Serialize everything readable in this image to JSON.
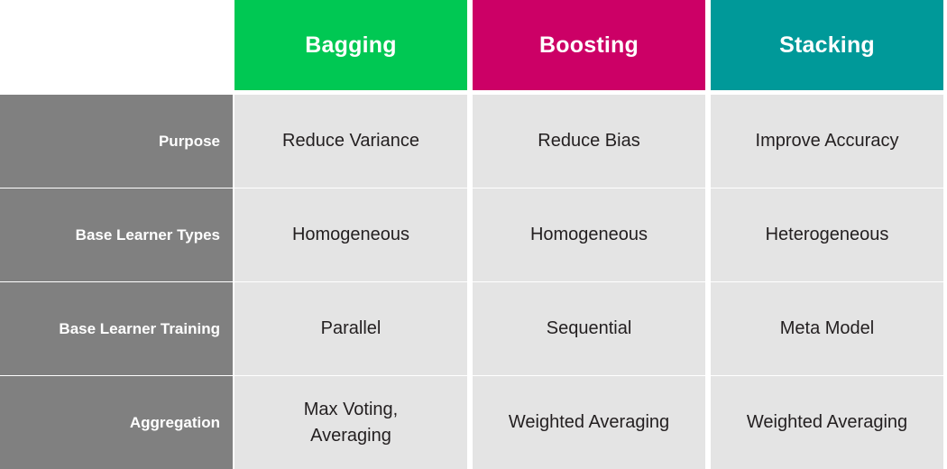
{
  "table": {
    "corner_label": "",
    "columns": [
      {
        "label": "Bagging",
        "color": "#00c853",
        "key": "bagging"
      },
      {
        "label": "Boosting",
        "color": "#cc0066",
        "key": "boosting"
      },
      {
        "label": "Stacking",
        "color": "#009999",
        "key": "stacking"
      }
    ],
    "row_labels": [
      "Purpose",
      "Base Learner Types",
      "Base Learner Training",
      "Aggregation"
    ],
    "rows": [
      {
        "label": "Purpose",
        "cells": [
          "Reduce Variance",
          "Reduce Bias",
          "Improve Accuracy"
        ]
      },
      {
        "label": "Base Learner Types",
        "cells": [
          "Homogeneous",
          "Homogeneous",
          "Heterogeneous"
        ]
      },
      {
        "label": "Base Learner Training",
        "cells": [
          "Parallel",
          "Sequential",
          "Meta Model"
        ]
      },
      {
        "label": "Aggregation",
        "cells": [
          "Max Voting, Averaging",
          "Weighted Averaging",
          "Weighted Averaging"
        ]
      }
    ],
    "colors": {
      "bagging_header": "#00c853",
      "boosting_header": "#cc0066",
      "stacking_header": "#009999",
      "row_label_background": "#808080",
      "data_cell_background": "#e4e4e4",
      "page_background": "#ffffff",
      "header_text": "#ffffff",
      "data_text": "#231f20"
    }
  }
}
